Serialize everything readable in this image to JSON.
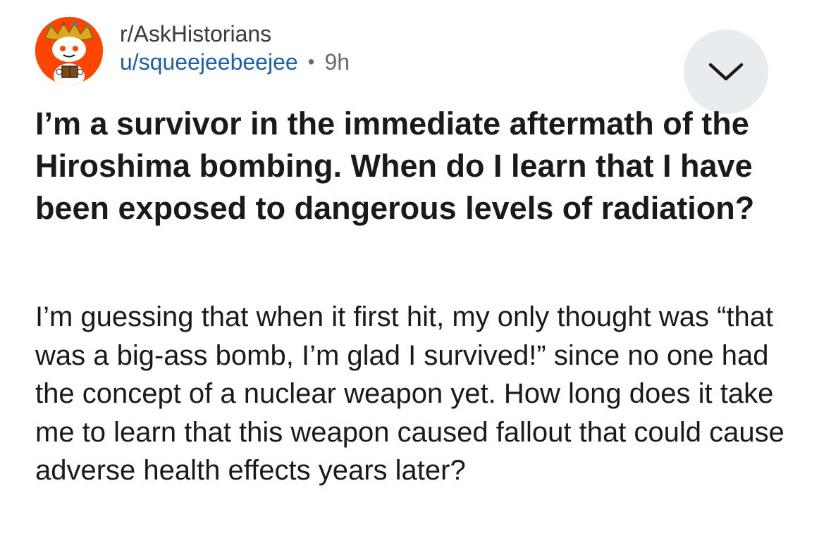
{
  "post": {
    "subreddit": "r/AskHistorians",
    "author": "u/squeejeebeejee",
    "separator": "•",
    "age": "9h",
    "title": "I’m a survivor in the immediate aftermath of the Hiroshima bombing. When do I learn that I have been exposed to dangerous levels of radiation?",
    "body": "I’m guessing that when it first hit, my only thought was “that was a big-ass bomb, I’m glad I survived!” since no one had the concept of a nuclear weapon yet. How long does it take me to learn that this weapon caused fallout that could cause adverse health effects years later?"
  },
  "icons": {
    "avatar": "subreddit-avatar-icon",
    "collapse": "chevron-down-icon"
  },
  "colors": {
    "avatar_bg": "#ff4500",
    "username": "#1c5fa8",
    "collapse_bg": "#e8ecef",
    "text": "#1a1a1b",
    "muted": "#6b6b6e"
  }
}
